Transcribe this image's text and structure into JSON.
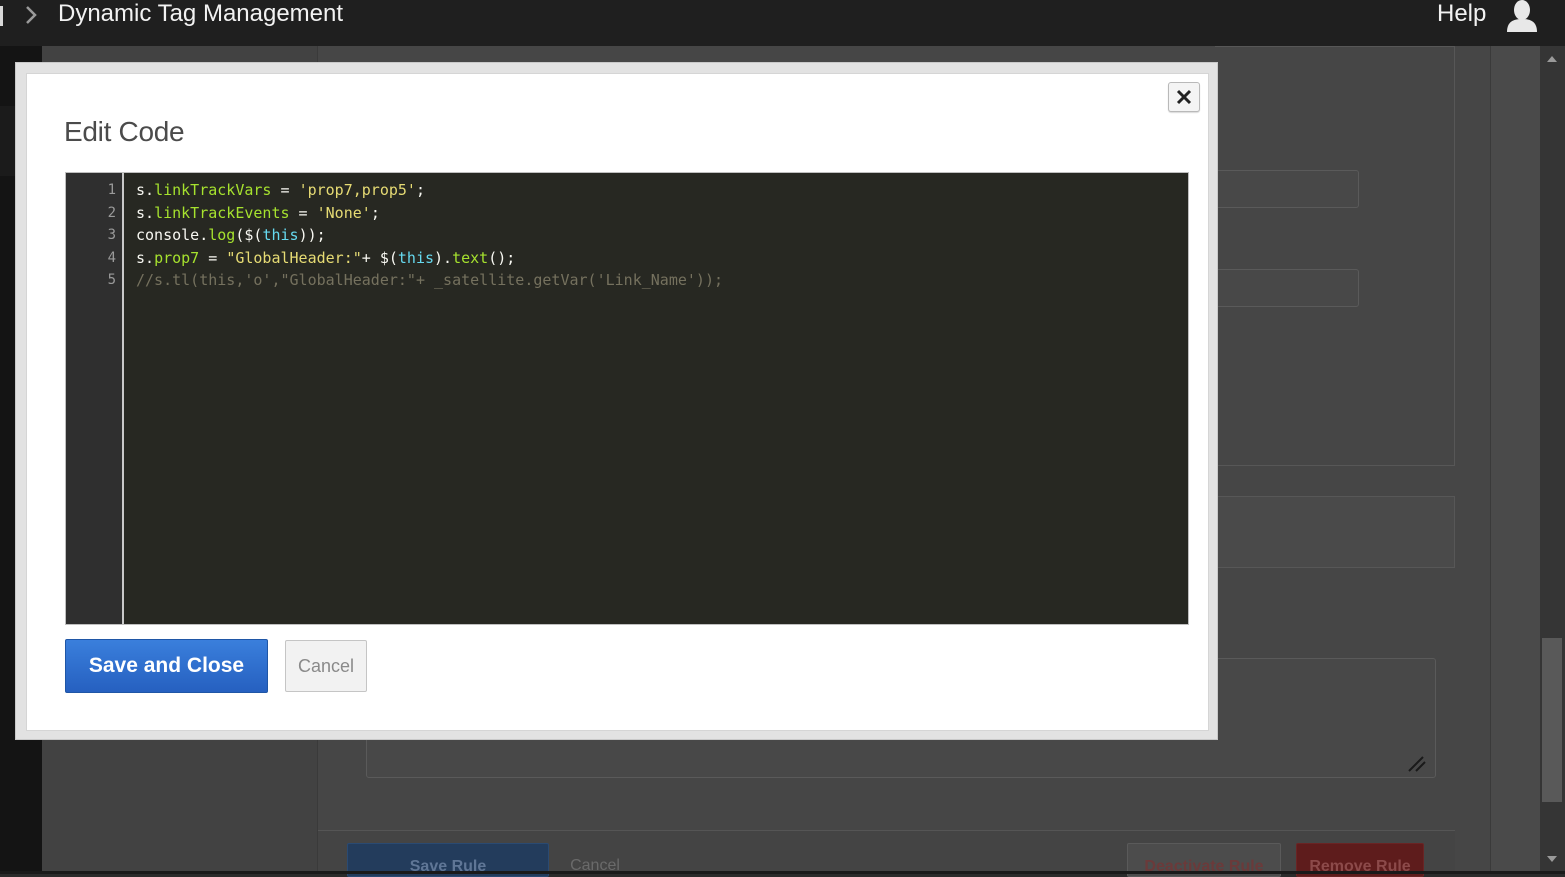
{
  "topbar": {
    "app_title": "Dynamic Tag Management",
    "help_label": "Help",
    "chevron_icon": "chevron-right-icon",
    "user_icon": "user-icon"
  },
  "modal": {
    "title": "Edit Code",
    "close_icon": "close-icon",
    "editor": {
      "lines": [
        {
          "number": "1",
          "tokens": [
            {
              "t": "s.",
              "c": "plain"
            },
            {
              "t": "linkTrackVars",
              "c": "prop"
            },
            {
              "t": " = ",
              "c": "plain"
            },
            {
              "t": "'prop7,prop5'",
              "c": "str"
            },
            {
              "t": ";",
              "c": "plain"
            }
          ]
        },
        {
          "number": "2",
          "tokens": [
            {
              "t": "s.",
              "c": "plain"
            },
            {
              "t": "linkTrackEvents",
              "c": "prop"
            },
            {
              "t": " = ",
              "c": "plain"
            },
            {
              "t": "'None'",
              "c": "str"
            },
            {
              "t": ";",
              "c": "plain"
            }
          ]
        },
        {
          "number": "3",
          "tokens": [
            {
              "t": "console.",
              "c": "plain"
            },
            {
              "t": "log",
              "c": "prop"
            },
            {
              "t": "($(",
              "c": "plain"
            },
            {
              "t": "this",
              "c": "this"
            },
            {
              "t": "));",
              "c": "plain"
            }
          ]
        },
        {
          "number": "4",
          "tokens": [
            {
              "t": "s.",
              "c": "plain"
            },
            {
              "t": "prop7",
              "c": "prop"
            },
            {
              "t": " = ",
              "c": "plain"
            },
            {
              "t": "\"GlobalHeader:\"",
              "c": "str"
            },
            {
              "t": "+ $(",
              "c": "plain"
            },
            {
              "t": "this",
              "c": "this"
            },
            {
              "t": ").",
              "c": "plain"
            },
            {
              "t": "text",
              "c": "prop"
            },
            {
              "t": "();",
              "c": "plain"
            }
          ]
        },
        {
          "number": "5",
          "tokens": [
            {
              "t": "//s.tl(this,'o',\"GlobalHeader:\"+ _satellite.getVar('Link_Name'));",
              "c": "comment"
            }
          ]
        }
      ]
    },
    "save_label": "Save and Close",
    "cancel_label": "Cancel"
  },
  "background": {
    "save_rule_label": "Save Rule",
    "cancel_label": "Cancel",
    "deactivate_label": "Deactivate Rule",
    "remove_label": "Remove Rule"
  },
  "colors": {
    "accent": "#2d6fcf",
    "editor_bg": "#272822",
    "topbar_bg": "#1f1f1f",
    "remove_button": "#5e1c1c"
  }
}
